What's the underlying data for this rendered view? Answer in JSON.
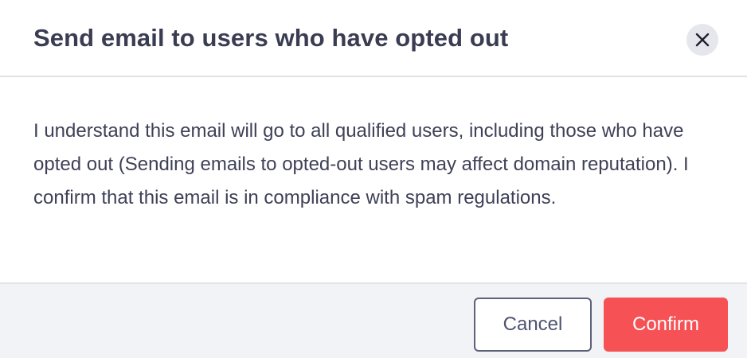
{
  "modal": {
    "title": "Send email to users who have opted out",
    "close_icon": "close-icon",
    "body_text": "I understand this email will go to all qualified users, including those who have opted out (Sending emails to opted-out users may affect domain reputation). I confirm that this email is in compliance with spam regulations.",
    "cancel_label": "Cancel",
    "confirm_label": "Confirm"
  },
  "colors": {
    "title_text": "#3a3d52",
    "confirm_button": "#f65155",
    "cancel_border": "#5d607a",
    "footer_background": "#f2f3f6",
    "close_button_background": "#e6e7ec"
  }
}
